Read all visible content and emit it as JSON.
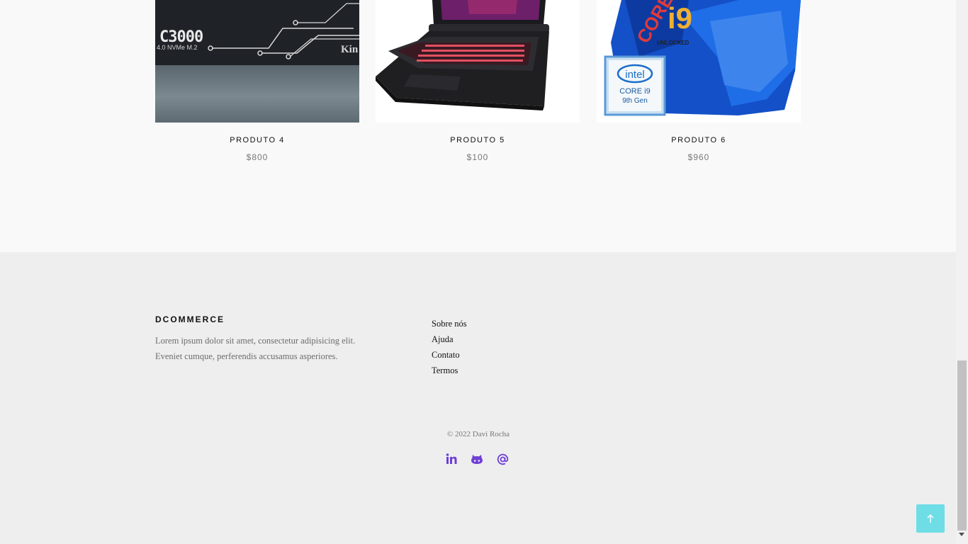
{
  "products": [
    {
      "name": "PRODUTO 4",
      "price": "$800",
      "image": "ssd-kingston-kc3000",
      "image_text": {
        "model": "C3000",
        "spec": "4.0 NVMe M.2",
        "brand": "Kin"
      }
    },
    {
      "name": "PRODUTO 5",
      "price": "$100",
      "image": "gaming-laptop"
    },
    {
      "name": "PRODUTO 6",
      "price": "$960",
      "image": "intel-core-i9-box",
      "image_text": {
        "brand": "intel",
        "line1": "CORE i9",
        "line2": "9th Gen",
        "box": "i9",
        "box_sub": "UNLOCKED",
        "box_side": "CORE"
      }
    }
  ],
  "footer": {
    "brand": "DCOMMERCE",
    "description": "Lorem ipsum dolor sit amet, consectetur adipisicing elit. Eveniet cumque, perferendis accusamus asperiores.",
    "links": [
      "Sobre nós",
      "Ajuda",
      "Contato",
      "Termos"
    ],
    "copyright": "© 2022 Davi Rocha",
    "social_icons": [
      "linkedin-icon",
      "github-icon",
      "email-at-icon"
    ]
  },
  "back_to_top_icon": "arrow-up-icon",
  "colors": {
    "accent": "#6f3fd6",
    "back_to_top": "#6fdde6",
    "products_bg": "#f9f9f9",
    "footer_bg": "#eeeeee"
  }
}
